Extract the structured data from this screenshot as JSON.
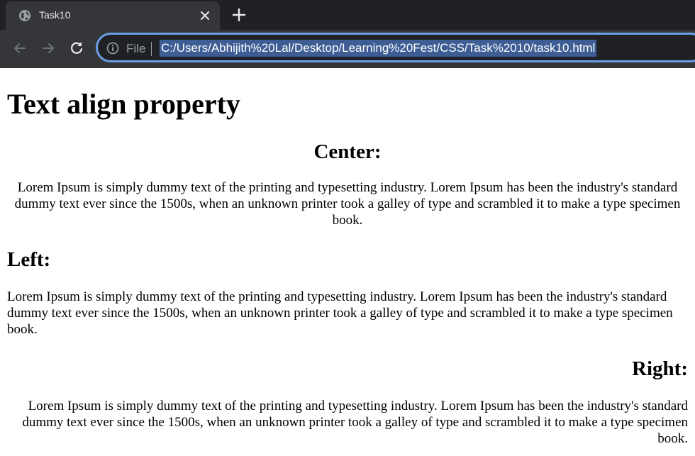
{
  "browser": {
    "tab_title": "Task10",
    "address_label": "File",
    "url": "C:/Users/Abhijith%20Lal/Desktop/Learning%20Fest/CSS/Task%2010/task10.html"
  },
  "page": {
    "title": "Text align property",
    "sections": [
      {
        "heading": "Center:",
        "text": "Lorem Ipsum is simply dummy text of the printing and typesetting industry. Lorem Ipsum has been the industry's standard dummy text ever since the 1500s, when an unknown printer took a galley of type and scrambled it to make a type specimen book."
      },
      {
        "heading": "Left:",
        "text": "Lorem Ipsum is simply dummy text of the printing and typesetting industry. Lorem Ipsum has been the industry's standard dummy text ever since the 1500s, when an unknown printer took a galley of type and scrambled it to make a type specimen book."
      },
      {
        "heading": "Right:",
        "text": "Lorem Ipsum is simply dummy text of the printing and typesetting industry. Lorem Ipsum has been the industry's standard dummy text ever since the 1500s, when an unknown printer took a galley of type and scrambled it to make a type specimen book."
      }
    ]
  }
}
